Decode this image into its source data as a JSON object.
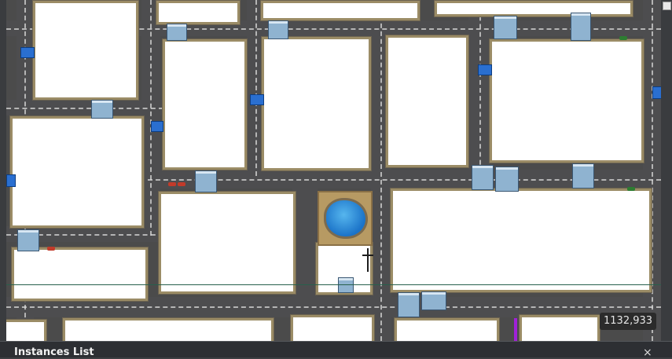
{
  "map_view": {
    "coordinate_readout": "1132,933"
  },
  "instances_panel": {
    "title": "Instances List",
    "close_symbol": "×"
  },
  "colors": {
    "road": "#4d4d4f",
    "block": "#ffffff",
    "pond": "#2a8fe0",
    "guide_line": "#27604c",
    "marker": "#a020d8"
  }
}
